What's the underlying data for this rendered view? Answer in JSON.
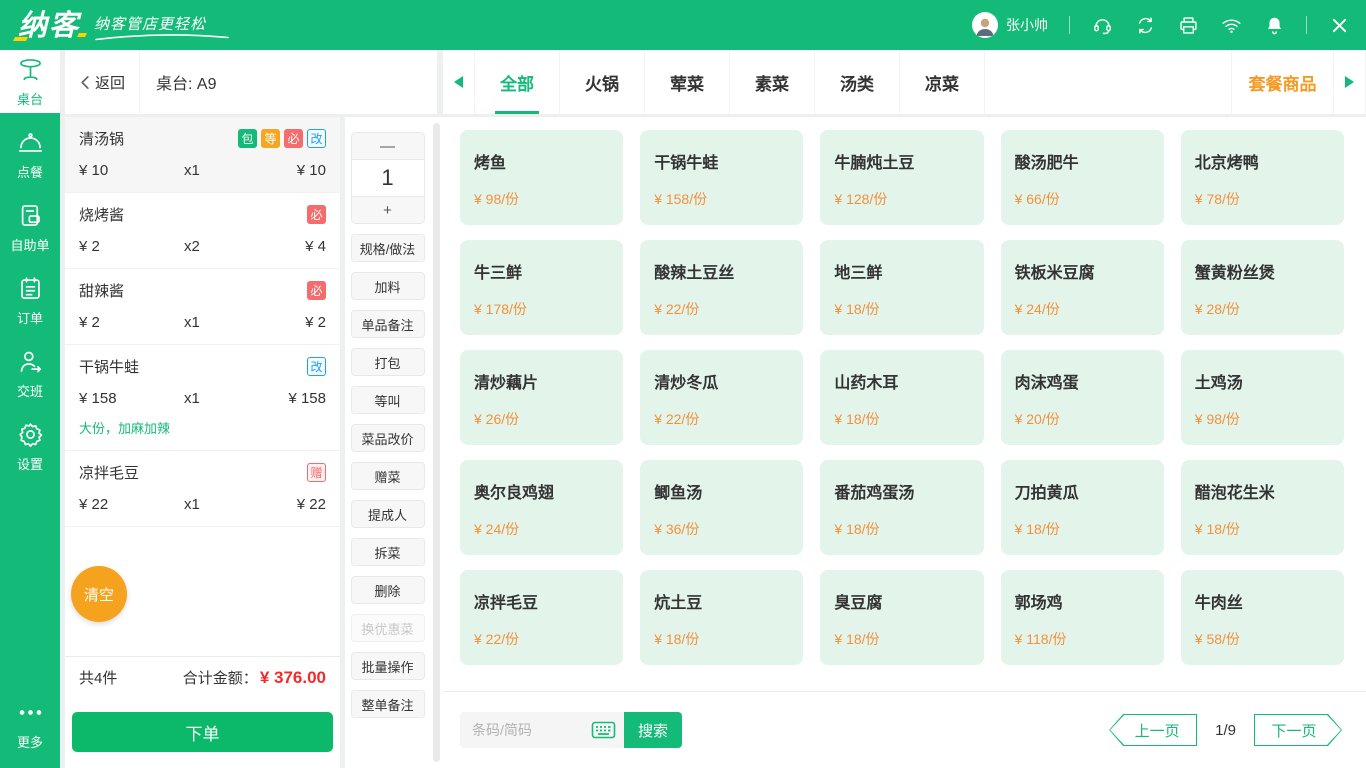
{
  "colors": {
    "brand_green": "#14ba77",
    "submit_green": "#0cb96a",
    "accent_orange": "#f5a31f",
    "combo_orange": "#f59a23",
    "price_orange": "#f2913d",
    "danger_red": "#f42a2a",
    "badge_red": "#f56c6c",
    "badge_blue": "#1e9fff",
    "card_mint": "#e3f5eb"
  },
  "topbar": {
    "logo": "纳客",
    "slogan": "纳客管店更轻松",
    "user_name": "张小帅",
    "icons": [
      "support-icon",
      "sync-icon",
      "printer-icon",
      "wifi-icon",
      "bell-icon",
      "close-icon"
    ]
  },
  "sidebar": {
    "items": [
      {
        "label": "桌台",
        "icon": "table-icon",
        "active": true
      },
      {
        "label": "点餐",
        "icon": "dish-cloche-icon",
        "active": false
      },
      {
        "label": "自助单",
        "icon": "self-order-icon",
        "active": false
      },
      {
        "label": "订单",
        "icon": "order-list-icon",
        "active": false
      },
      {
        "label": "交班",
        "icon": "shift-change-icon",
        "active": false
      },
      {
        "label": "设置",
        "icon": "settings-gear-icon",
        "active": false
      }
    ],
    "more": "更多"
  },
  "subheader": {
    "back": "返回",
    "table": "桌台: A9"
  },
  "tabs": {
    "items": [
      {
        "label": "全部",
        "active": true
      },
      {
        "label": "火锅",
        "active": false
      },
      {
        "label": "荤菜",
        "active": false
      },
      {
        "label": "素菜",
        "active": false
      },
      {
        "label": "汤类",
        "active": false
      },
      {
        "label": "凉菜",
        "active": false
      }
    ],
    "combo": "套餐商品"
  },
  "order": {
    "items": [
      {
        "name": "清汤锅",
        "price": "¥ 10",
        "qty": "x1",
        "total": "¥ 10",
        "selected": true,
        "badges": [
          {
            "t": "包",
            "s": "g"
          },
          {
            "t": "等",
            "s": "o"
          },
          {
            "t": "必",
            "s": "r"
          },
          {
            "t": "改",
            "s": "ob"
          }
        ]
      },
      {
        "name": "烧烤酱",
        "price": "¥ 2",
        "qty": "x2",
        "total": "¥ 4",
        "selected": false,
        "badges": [
          {
            "t": "必",
            "s": "r"
          }
        ]
      },
      {
        "name": "甜辣酱",
        "price": "¥ 2",
        "qty": "x1",
        "total": "¥ 2",
        "selected": false,
        "badges": [
          {
            "t": "必",
            "s": "r"
          }
        ]
      },
      {
        "name": "干锅牛蛙",
        "price": "¥ 158",
        "qty": "x1",
        "total": "¥ 158",
        "selected": false,
        "note": "大份，加麻加辣",
        "badges": [
          {
            "t": "改",
            "s": "ob"
          }
        ]
      },
      {
        "name": "凉拌毛豆",
        "price": "¥ 22",
        "qty": "x1",
        "total": "¥ 22",
        "selected": false,
        "badges": [
          {
            "t": "赠",
            "s": "or"
          }
        ]
      }
    ],
    "clear": "清空",
    "count": "共4件",
    "total_label": "合计金额：",
    "total_value": "¥ 376.00",
    "submit": "下单"
  },
  "actions": {
    "minus": "—",
    "qty": "1",
    "plus": "+",
    "buttons": [
      {
        "label": "规格/做法",
        "disabled": false
      },
      {
        "label": "加料",
        "disabled": false
      },
      {
        "label": "单品备注",
        "disabled": false
      },
      {
        "label": "打包",
        "disabled": false
      },
      {
        "label": "等叫",
        "disabled": false
      },
      {
        "label": "菜品改价",
        "disabled": false
      },
      {
        "label": "赠菜",
        "disabled": false
      },
      {
        "label": "提成人",
        "disabled": false
      },
      {
        "label": "拆菜",
        "disabled": false
      },
      {
        "label": "删除",
        "disabled": false
      },
      {
        "label": "换优惠菜",
        "disabled": true
      },
      {
        "label": "批量操作",
        "disabled": false
      },
      {
        "label": "整单备注",
        "disabled": false
      }
    ]
  },
  "menu": {
    "items": [
      {
        "name": "烤鱼",
        "price": "¥ 98/份"
      },
      {
        "name": "干锅牛蛙",
        "price": "¥ 158/份"
      },
      {
        "name": "牛腩炖土豆",
        "price": "¥ 128/份"
      },
      {
        "name": "酸汤肥牛",
        "price": "¥ 66/份"
      },
      {
        "name": "北京烤鸭",
        "price": "¥ 78/份"
      },
      {
        "name": "牛三鲜",
        "price": "¥ 178/份"
      },
      {
        "name": "酸辣土豆丝",
        "price": "¥ 22/份"
      },
      {
        "name": "地三鲜",
        "price": "¥ 18/份"
      },
      {
        "name": "铁板米豆腐",
        "price": "¥ 24/份"
      },
      {
        "name": "蟹黄粉丝煲",
        "price": "¥ 28/份"
      },
      {
        "name": "清炒藕片",
        "price": "¥ 26/份"
      },
      {
        "name": "清炒冬瓜",
        "price": "¥ 22/份"
      },
      {
        "name": "山药木耳",
        "price": "¥ 18/份"
      },
      {
        "name": "肉沫鸡蛋",
        "price": "¥ 20/份"
      },
      {
        "name": "土鸡汤",
        "price": "¥ 98/份"
      },
      {
        "name": "奥尔良鸡翅",
        "price": "¥ 24/份"
      },
      {
        "name": "鲫鱼汤",
        "price": "¥ 36/份"
      },
      {
        "name": "番茄鸡蛋汤",
        "price": "¥ 18/份"
      },
      {
        "name": "刀拍黄瓜",
        "price": "¥ 18/份"
      },
      {
        "name": "醋泡花生米",
        "price": "¥ 18/份"
      },
      {
        "name": "凉拌毛豆",
        "price": "¥ 22/份"
      },
      {
        "name": "炕土豆",
        "price": "¥ 18/份"
      },
      {
        "name": "臭豆腐",
        "price": "¥ 18/份"
      },
      {
        "name": "郭场鸡",
        "price": "¥ 118/份"
      },
      {
        "name": "牛肉丝",
        "price": "¥ 58/份"
      }
    ]
  },
  "footer": {
    "search_placeholder": "条码/简码",
    "keyboard_icon": "keyboard-icon",
    "search_button": "搜索",
    "prev": "上一页",
    "page": "1/9",
    "next": "下一页"
  }
}
